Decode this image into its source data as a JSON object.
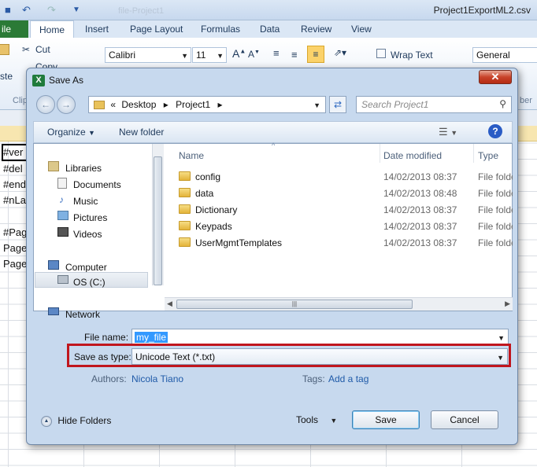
{
  "excel": {
    "doc_title": "Project1ExportML2.csv",
    "ghost_title": "file-Project1",
    "file_tab": "ile",
    "tabs": [
      "Home",
      "Insert",
      "Page Layout",
      "Formulas",
      "Data",
      "Review",
      "View"
    ],
    "cut": "Cut",
    "copy": "Copy",
    "paste": "ste",
    "clipboard_group": "Clip",
    "font": "Calibri",
    "font_size": "11",
    "wrap_text": "Wrap Text",
    "number_format": "General",
    "number_group": "ber",
    "cells": [
      "#ver",
      "#del",
      "#end",
      "#nLa",
      "",
      "#Pag",
      "Page",
      "Page"
    ]
  },
  "dialog": {
    "title": "Save As",
    "breadcrumb": [
      "«",
      "Desktop",
      "Project1"
    ],
    "search_placeholder": "Search Project1",
    "organize_label": "Organize",
    "new_folder_label": "New folder",
    "nav_items": [
      {
        "label": "Libraries",
        "icon": "libraries-icon"
      },
      {
        "label": "Documents",
        "icon": "documents-icon"
      },
      {
        "label": "Music",
        "icon": "music-icon"
      },
      {
        "label": "Pictures",
        "icon": "pictures-icon"
      },
      {
        "label": "Videos",
        "icon": "videos-icon"
      },
      {
        "label": "Computer",
        "icon": "computer-icon"
      },
      {
        "label": "OS (C:)",
        "icon": "drive-icon"
      },
      {
        "label": "Network",
        "icon": "network-icon"
      }
    ],
    "columns": {
      "name": "Name",
      "date": "Date modified",
      "type": "Type"
    },
    "files": [
      {
        "name": "config",
        "date": "14/02/2013 08:37",
        "type": "File folder"
      },
      {
        "name": "data",
        "date": "14/02/2013 08:48",
        "type": "File folder"
      },
      {
        "name": "Dictionary",
        "date": "14/02/2013 08:37",
        "type": "File folder"
      },
      {
        "name": "Keypads",
        "date": "14/02/2013 08:37",
        "type": "File folder"
      },
      {
        "name": "UserMgmtTemplates",
        "date": "14/02/2013 08:37",
        "type": "File folder"
      }
    ],
    "file_name_label": "File name:",
    "file_name_value": "my_file",
    "save_as_type_label": "Save as type:",
    "save_as_type_value": "Unicode Text (*.txt)",
    "authors_label": "Authors:",
    "authors_value": "Nicola Tiano",
    "tags_label": "Tags:",
    "tags_value": "Add a tag",
    "hide_folders_label": "Hide Folders",
    "tools_label": "Tools",
    "save_label": "Save",
    "cancel_label": "Cancel",
    "highlight_color": "#c0161d"
  }
}
